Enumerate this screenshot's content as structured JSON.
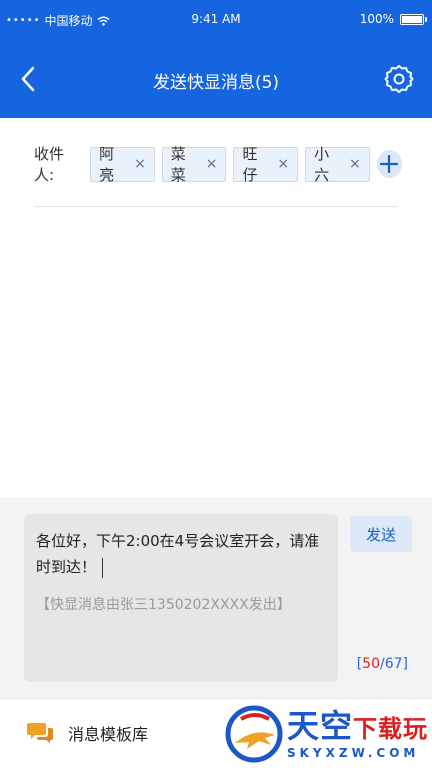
{
  "status_bar": {
    "signal": "•••••",
    "carrier": "中国移动",
    "time": "9:41 AM",
    "battery": "100%"
  },
  "nav": {
    "title": "发送快显消息(5)",
    "back_icon": "chevron-left-icon",
    "settings_icon": "gear-icon"
  },
  "recipients": {
    "label": "收件人:",
    "items": [
      {
        "name": "阿亮",
        "remove": "×"
      },
      {
        "name": "菜菜",
        "remove": "×"
      },
      {
        "name": "旺仔",
        "remove": "×"
      },
      {
        "name": "小六",
        "remove": "×"
      }
    ],
    "add_icon": "plus-icon"
  },
  "compose": {
    "message": "各位好，下午2:00在4号会议室开会，请准时到达！",
    "signature": "【快显消息由张三1350202XXXX发出】",
    "send_label": "发送",
    "counter": {
      "open": "[",
      "current": "50",
      "sep": "/",
      "max": "67",
      "close": "]"
    }
  },
  "bottom_bar": {
    "template_label": "消息模板库",
    "template_icon": "chat-bubbles-icon"
  },
  "watermark": {
    "main": "天空",
    "accent": "下载玩",
    "sub": "SKYXZW.COM"
  },
  "colors": {
    "primary": "#1565e0",
    "chip_bg": "#e9f1fb",
    "counter_current": "#d7261e",
    "icon_orange": "#f0a224"
  }
}
